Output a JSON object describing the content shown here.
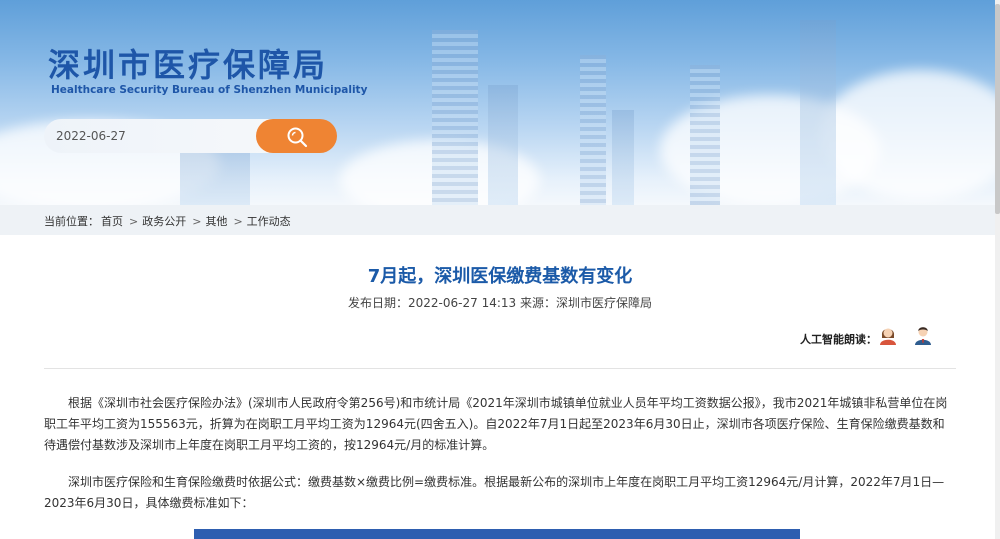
{
  "header": {
    "title": "深圳市医疗保障局",
    "subtitle": "Healthcare Security Bureau of Shenzhen Municipality",
    "search_value": "2022-06-27",
    "search_icon": "search-icon",
    "accent_color": "#ef8433",
    "brand_color": "#1e56a8"
  },
  "breadcrumb": {
    "prefix": "当前位置：",
    "items": [
      "首页",
      "政务公开",
      "其他",
      "工作动态"
    ],
    "separator": ">"
  },
  "article": {
    "title": "7月起，深圳医保缴费基数有变化",
    "meta": "发布日期：2022-06-27 14:13 来源：深圳市医疗保障局",
    "ai_read_label": "人工智能朗读：",
    "paragraphs": [
      "根据《深圳市社会医疗保险办法》(深圳市人民政府令第256号)和市统计局《2021年深圳市城镇单位就业人员年平均工资数据公报》，我市2021年城镇非私营单位在岗职工年平均工资为155563元，折算为在岗职工月平均工资为12964元(四舍五入)。自2022年7月1日起至2023年6月30日止，深圳市各项医疗保险、生育保险缴费基数和待遇偿付基数涉及深圳市上年度在岗职工月平均工资的，按12964元/月的标准计算。",
      "深圳市医疗保险和生育保险缴费时依据公式：缴费基数×缴费比例=缴费标准。根据最新公布的深圳市上年度在岗职工月平均工资12964元/月计算，2022年7月1日—2023年6月30日，具体缴费标准如下："
    ]
  }
}
